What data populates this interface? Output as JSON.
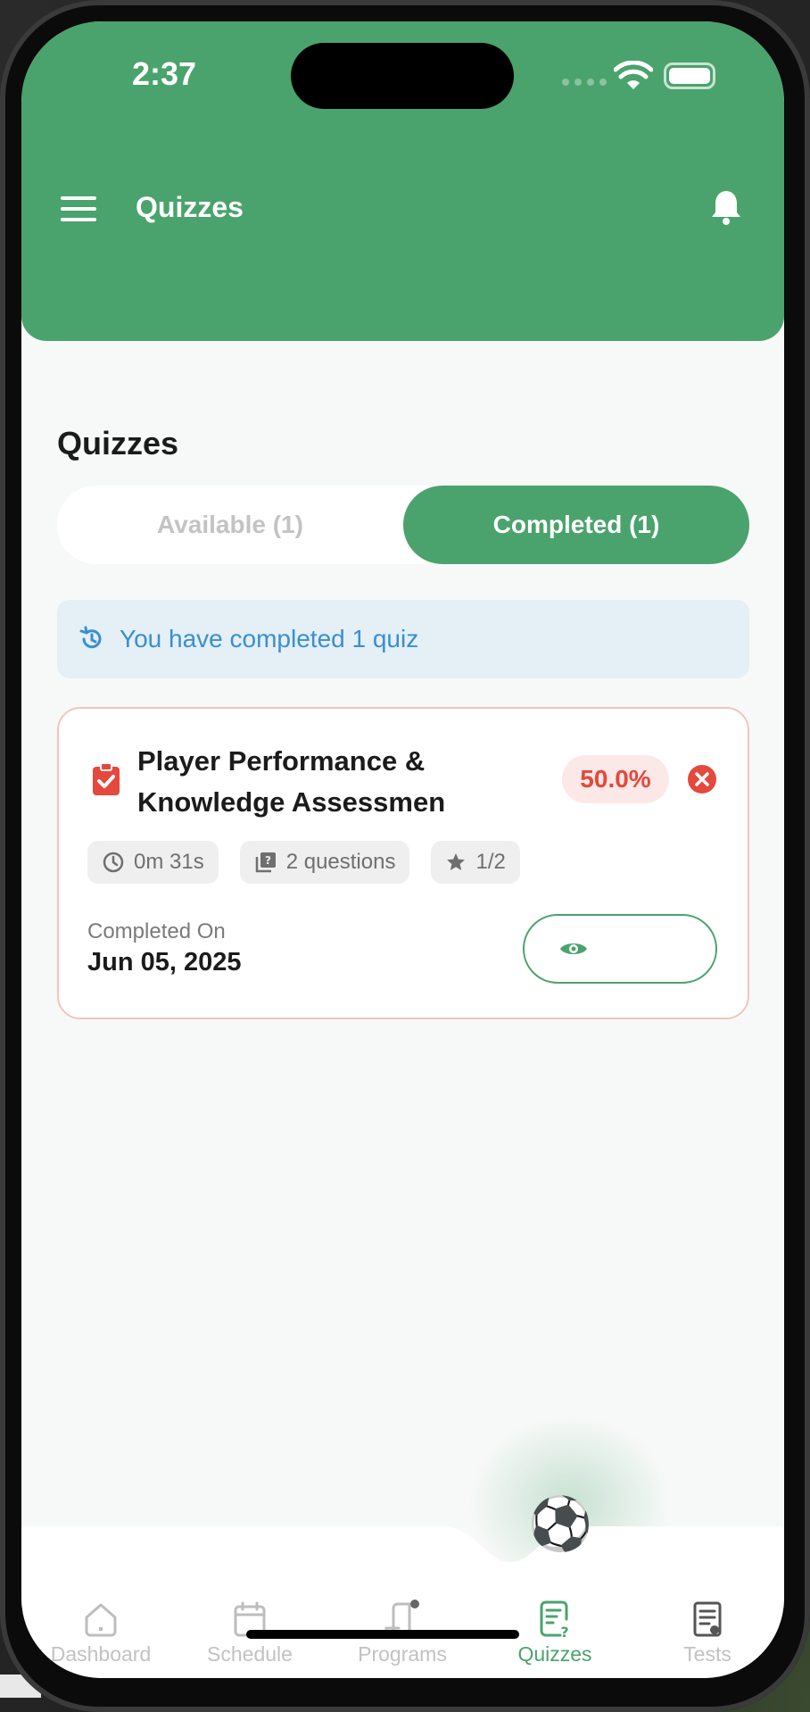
{
  "status_bar": {
    "time": "2:37"
  },
  "header": {
    "title": "Quizzes"
  },
  "page": {
    "heading": "Quizzes"
  },
  "tabs": [
    {
      "label": "Available (1)",
      "active": false
    },
    {
      "label": "Completed (1)",
      "active": true
    }
  ],
  "info_banner": {
    "text": "You have completed 1 quiz",
    "icon": "history-icon"
  },
  "quiz_card": {
    "title": "Player Performance & Knowledge Assessmen",
    "score": "50.0%",
    "status": "failed",
    "stats": {
      "duration": "0m 31s",
      "questions": "2 questions",
      "correct": "1/2"
    },
    "completed_label": "Completed On",
    "completed_date": "Jun 05, 2025"
  },
  "bottom_nav": [
    {
      "label": "Dashboard",
      "icon": "home-icon",
      "active": false
    },
    {
      "label": "Schedule",
      "icon": "calendar-icon",
      "active": false
    },
    {
      "label": "Programs",
      "icon": "scroll-icon",
      "active": false
    },
    {
      "label": "Quizzes",
      "icon": "quiz-icon",
      "active": true
    },
    {
      "label": "Tests",
      "icon": "document-icon",
      "active": false
    }
  ],
  "colors": {
    "primary": "#4aa36c",
    "danger": "#e5483c",
    "info": "#3a8fd0",
    "info_bg": "#e4eff6"
  }
}
